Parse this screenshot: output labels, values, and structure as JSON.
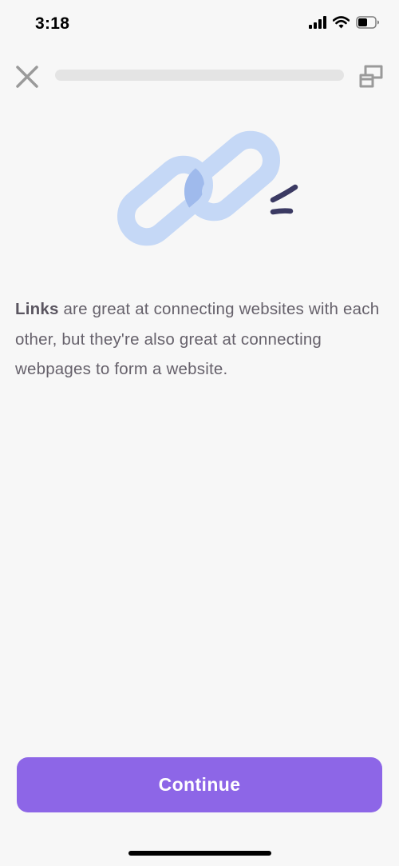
{
  "status_bar": {
    "time": "3:18",
    "icons": [
      "signal-icon",
      "wifi-icon",
      "battery-icon"
    ]
  },
  "top_bar": {
    "close_icon": "close-icon",
    "progress": 0.0,
    "switch_icon": "switch-view-icon"
  },
  "illustration": {
    "icon": "chain-link-icon",
    "colors": {
      "link": "#c5d8f6",
      "overlap": "#9fbaec",
      "accent": "#3b3a63"
    }
  },
  "content": {
    "bold_term": "Links",
    "body_rest": " are great at connecting websites with each other, but they're also great at connecting webpages to form a website."
  },
  "footer": {
    "continue_label": "Continue"
  },
  "colors": {
    "background": "#f7f7f7",
    "accent": "#8d66e7",
    "text": "#66616b"
  }
}
